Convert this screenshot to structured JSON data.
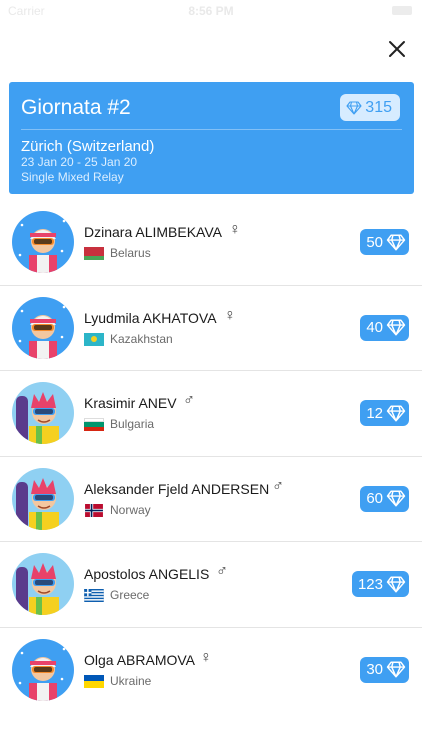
{
  "status_bar": {
    "carrier": "Carrier",
    "time": "8:56 PM"
  },
  "event": {
    "title": "Giornata #2",
    "gems": "315",
    "location": "Zürich (Switzerland)",
    "dates": "23 Jan 20 - 25 Jan 20",
    "race": "Single Mixed Relay"
  },
  "athletes": [
    {
      "name": "Dzinara ALIMBEKAVA",
      "gender": "♀",
      "country": "Belarus",
      "points": "50"
    },
    {
      "name": "Lyudmila AKHATOVA",
      "gender": "♀",
      "country": "Kazakhstan",
      "points": "40"
    },
    {
      "name": "Krasimir ANEV",
      "gender": "♂",
      "country": "Bulgaria",
      "points": "12"
    },
    {
      "name": "Aleksander Fjeld ANDERSEN",
      "gender": "♂",
      "country": "Norway",
      "points": "60"
    },
    {
      "name": "Apostolos ANGELIS",
      "gender": "♂",
      "country": "Greece",
      "points": "123"
    },
    {
      "name": "Olga ABRAMOVA",
      "gender": "♀",
      "country": "Ukraine",
      "points": "30"
    }
  ],
  "colors": {
    "accent": "#3f9ff2",
    "badge_light": "#d7ecff"
  },
  "icons": {
    "close": "close-icon",
    "gem": "diamond-icon",
    "female": "female-symbol",
    "male": "male-symbol"
  }
}
